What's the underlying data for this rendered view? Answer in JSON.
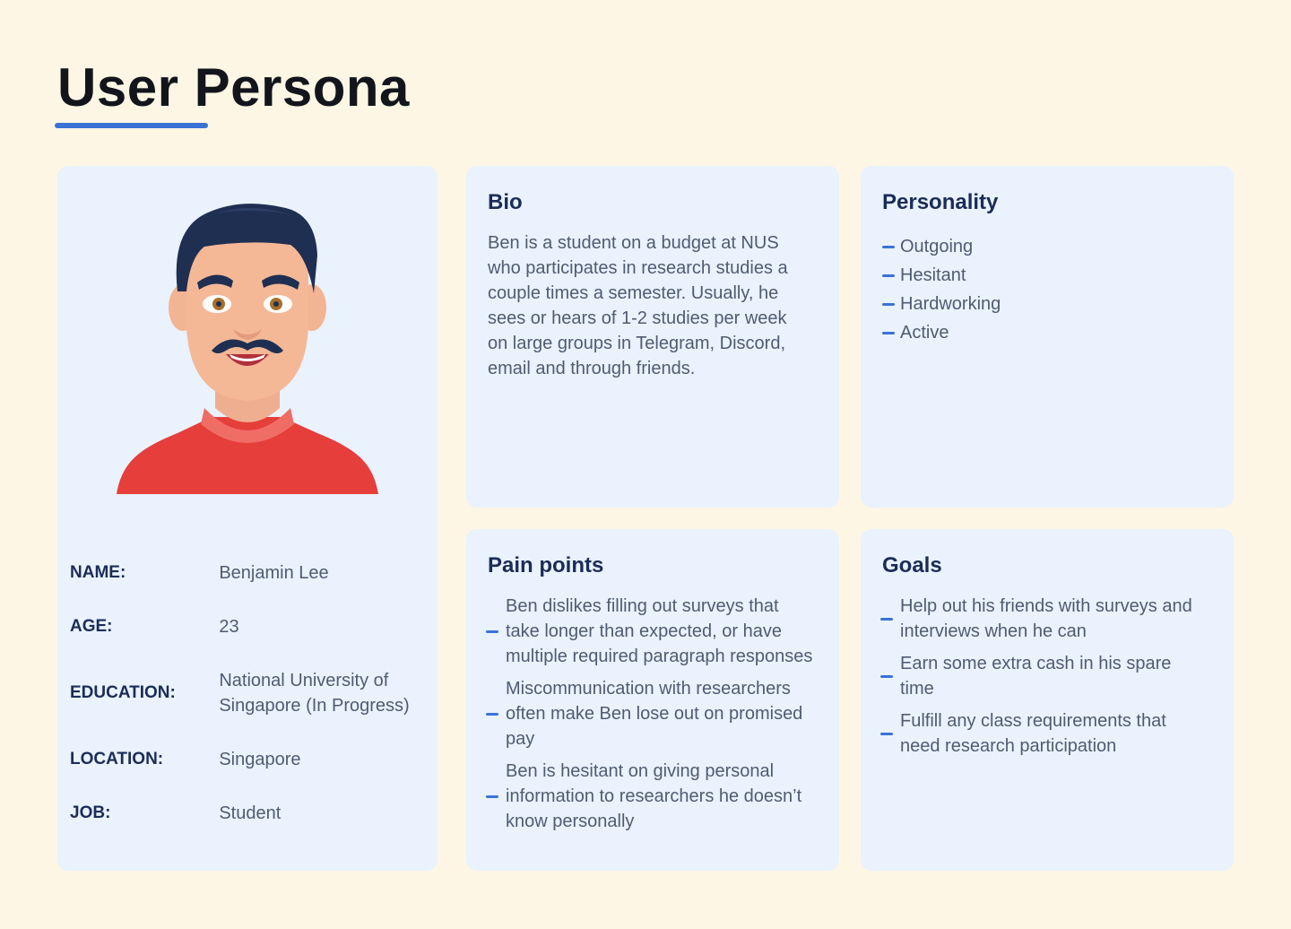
{
  "page": {
    "title": "User Persona",
    "accent_color": "#3a72d6",
    "background_color": "#fdf6e4",
    "card_color": "#e9f2fd"
  },
  "profile": {
    "avatar_icon": "male-avatar-illustration",
    "fields": [
      {
        "label": "NAME:",
        "value": "Benjamin Lee"
      },
      {
        "label": "AGE:",
        "value": "23"
      },
      {
        "label": "EDUCATION:",
        "value": "National University of Singapore (In Progress)"
      },
      {
        "label": "LOCATION:",
        "value": "Singapore"
      },
      {
        "label": "JOB:",
        "value": "Student"
      }
    ]
  },
  "bio": {
    "heading": "Bio",
    "text": "Ben is a student on a budget at NUS who participates in research studies a couple times a semester. Usually, he sees or hears of 1-2 studies per week on large groups in Telegram, Discord, email and through friends."
  },
  "personality": {
    "heading": "Personality",
    "items": [
      "Outgoing",
      "Hesitant",
      "Hardworking",
      "Active"
    ]
  },
  "pain_points": {
    "heading": "Pain points",
    "items": [
      "Ben dislikes filling out surveys that take longer than expected, or have multiple required paragraph responses",
      "Miscommunication with researchers often make Ben lose out on promised pay",
      "Ben is hesitant on giving personal information to researchers he doesn’t know personally"
    ]
  },
  "goals": {
    "heading": "Goals",
    "items": [
      "Help out his friends with surveys and interviews when he can",
      "Earn some extra cash in his spare time",
      "Fulfill any class requirements that need research participation"
    ]
  }
}
